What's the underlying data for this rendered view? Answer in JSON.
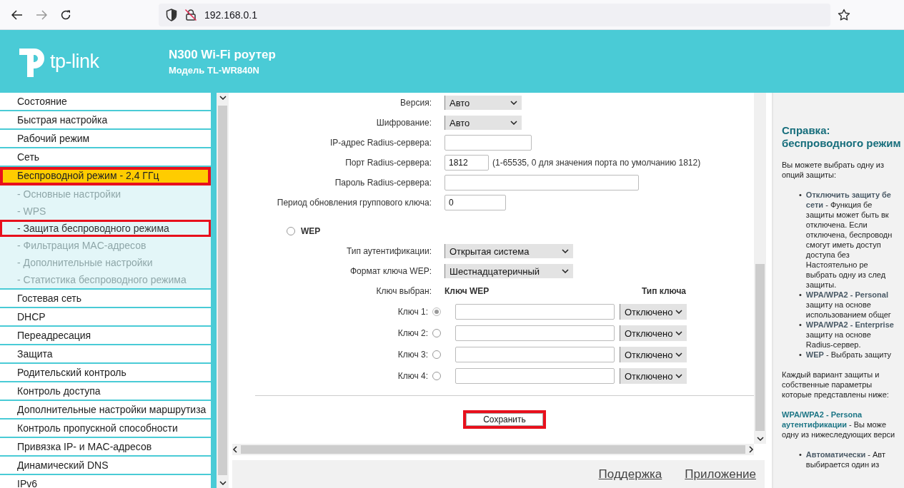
{
  "browser": {
    "url": "192.168.0.1"
  },
  "header": {
    "logo": "tp-link",
    "title": "N300 Wi-Fi роутер",
    "model": "Модель TL-WR840N"
  },
  "nav": [
    {
      "label": "Состояние",
      "selected": false,
      "annotated": false
    },
    {
      "label": "Быстрая настройка",
      "selected": false,
      "annotated": false
    },
    {
      "label": "Рабочий режим",
      "selected": false,
      "annotated": false
    },
    {
      "label": "Сеть",
      "selected": false,
      "annotated": false
    },
    {
      "label": "Беспроводной режим - 2,4 ГГц",
      "selected": true,
      "annotated": true,
      "expanded": true,
      "children": [
        {
          "label": "- Основные настройки",
          "selected": false,
          "annotated": false
        },
        {
          "label": "- WPS",
          "selected": false,
          "annotated": false
        },
        {
          "label": "- Защита беспроводного режима",
          "selected": true,
          "annotated": true
        },
        {
          "label": "- Фильтрация MAC-адресов",
          "selected": false,
          "annotated": false
        },
        {
          "label": "- Дополнительные настройки",
          "selected": false,
          "annotated": false
        },
        {
          "label": "- Статистика беспроводного режима",
          "selected": false,
          "annotated": false
        }
      ]
    },
    {
      "label": "Гостевая сеть",
      "selected": false,
      "annotated": false
    },
    {
      "label": "DHCP",
      "selected": false,
      "annotated": false
    },
    {
      "label": "Переадресация",
      "selected": false,
      "annotated": false
    },
    {
      "label": "Защита",
      "selected": false,
      "annotated": false
    },
    {
      "label": "Родительский контроль",
      "selected": false,
      "annotated": false
    },
    {
      "label": "Контроль доступа",
      "selected": false,
      "annotated": false
    },
    {
      "label": "Дополнительные настройки маршрутиза",
      "selected": false,
      "annotated": false
    },
    {
      "label": "Контроль пропускной способности",
      "selected": false,
      "annotated": false
    },
    {
      "label": "Привязка IP- и MAC-адресов",
      "selected": false,
      "annotated": false
    },
    {
      "label": "Динамический DNS",
      "selected": false,
      "annotated": false
    },
    {
      "label": "IPv6",
      "selected": false,
      "annotated": false
    }
  ],
  "form": [
    {
      "kind": "select",
      "label": "Версия:",
      "value": "Авто"
    },
    {
      "kind": "select",
      "label": "Шифрование:",
      "value": "Авто"
    },
    {
      "kind": "input",
      "label": "IP-адрес Radius-сервера:"
    },
    {
      "kind": "input",
      "label": "Порт Radius-сервера:",
      "value": "1812",
      "hint": "(1-65535, 0 для значения порта по умолчанию 1812)"
    },
    {
      "kind": "input",
      "label": "Пароль Radius-сервера:"
    },
    {
      "kind": "input",
      "label": "Период обновления группового ключа:",
      "value": "0"
    },
    {
      "kind": "radio",
      "label": "WEP",
      "selected": false
    },
    {
      "kind": "select",
      "label": "Тип аутентификации:",
      "value": "Открытая система"
    },
    {
      "kind": "select",
      "label": "Формат ключа WEP:",
      "value": "Шестнадцатеричный"
    },
    {
      "kind": "key-header",
      "label": "Ключ выбран:",
      "key_column": "Ключ WEP",
      "type_column": "Тип ключа"
    },
    {
      "kind": "key",
      "label": "Ключ 1:",
      "selected": true,
      "disabled": true,
      "type": "Отключено"
    },
    {
      "kind": "key",
      "label": "Ключ 2:",
      "selected": false,
      "disabled": false,
      "type": "Отключено"
    },
    {
      "kind": "key",
      "label": "Ключ 3:",
      "selected": false,
      "disabled": false,
      "type": "Отключено"
    },
    {
      "kind": "key",
      "label": "Ключ 4:",
      "selected": false,
      "disabled": false,
      "type": "Отключено"
    }
  ],
  "save_button": {
    "label": "Сохранить",
    "annotated": true
  },
  "footer_links": [
    "Поддержка",
    "Приложение"
  ],
  "help": {
    "title": [
      "Справка:",
      "беспроводного режим"
    ],
    "blocks": [
      {
        "kind": "para",
        "lines": [
          "Вы можете выбрать одну из",
          "опций защиты:"
        ]
      },
      {
        "kind": "bullets",
        "bullet": "•",
        "items": [
          [
            "**Отключить защиту бе**",
            "**сети** - Функция бе",
            "защиты может быть вк",
            "отключена. Если",
            "отключена, беспроводн",
            "смогут иметь доступ",
            "доступа без",
            "Настоятельно ре",
            "выбрать одну из след",
            "защиты."
          ],
          [
            "**WPA/WPA2 - Personal**",
            "защиту на основе",
            "использованием общег"
          ],
          [
            "**WPA/WPA2 - Enterprise**",
            "защиту на основе",
            "Radius-сервер."
          ],
          [
            "**WEP** - Выбрать защиту"
          ]
        ]
      },
      {
        "kind": "para",
        "lines": [
          "Каждый вариант защиты и",
          "собственные параметры",
          "которые представлены ниже:"
        ]
      },
      {
        "kind": "para",
        "lines": [
          "**WPA/WPA2 - Persona**",
          "**аутентификации** - Вы може",
          "одну из нижеследующих верси"
        ]
      },
      {
        "kind": "bullets",
        "bullet": "•",
        "items": [
          [
            "**Автоматически** - Авт",
            "выбирается один из"
          ]
        ]
      }
    ]
  }
}
